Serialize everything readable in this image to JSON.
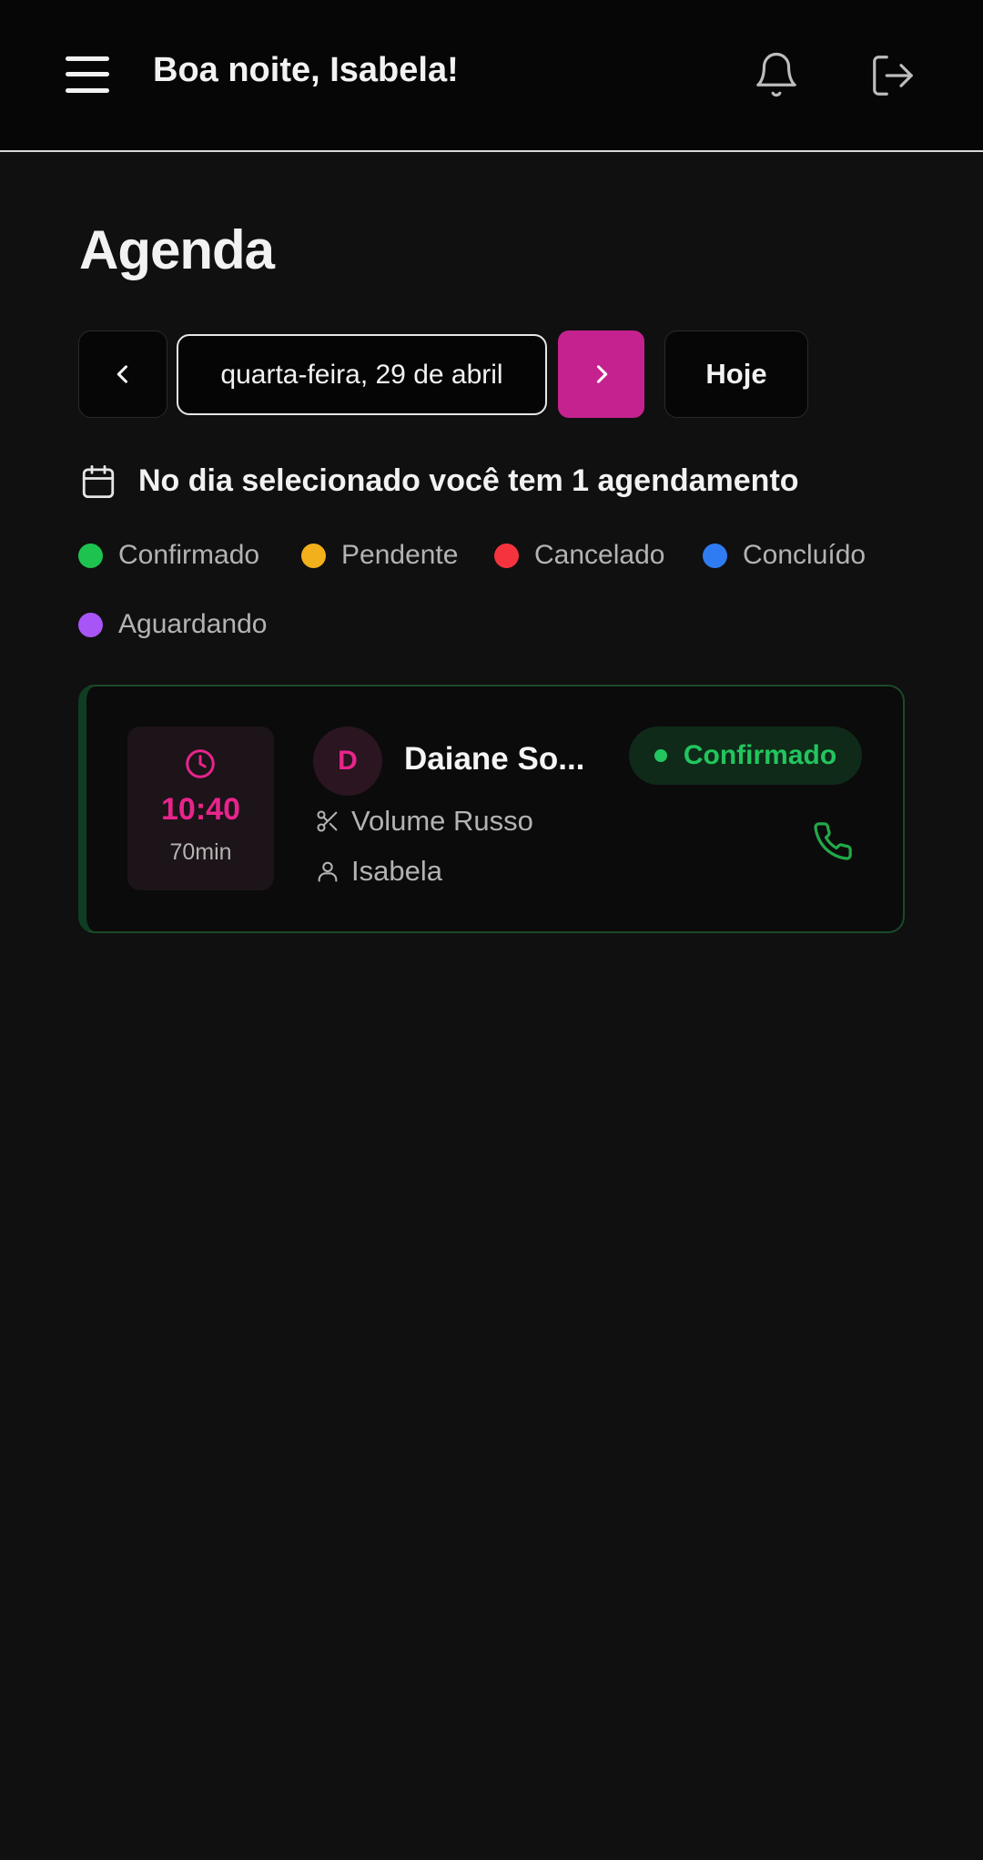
{
  "header": {
    "greeting": "Boa noite,  Isabela!",
    "menu_icon": "hamburger-menu-icon",
    "notifications_icon": "bell-icon",
    "logout_icon": "logout-icon"
  },
  "page": {
    "title": "Agenda"
  },
  "date_nav": {
    "selected_date": "quarta-feira, 29 de abril",
    "today_label": "Hoje",
    "accent_color": "#c5228f"
  },
  "summary": {
    "text": "No dia selecionado você tem 1 agendamento"
  },
  "legend": {
    "items": [
      {
        "label": "Confirmado",
        "color": "#1ec34f"
      },
      {
        "label": "Pendente",
        "color": "#f2b01c"
      },
      {
        "label": "Cancelado",
        "color": "#f5333f"
      },
      {
        "label": "Concluído",
        "color": "#2f7cf2"
      },
      {
        "label": "Aguardando",
        "color": "#a855f7"
      }
    ]
  },
  "appointments": [
    {
      "time": "10:40",
      "duration": "70min",
      "avatar_letter": "D",
      "client_name": "Daiane So...",
      "service": "Volume Russo",
      "professional": "Isabela",
      "status": "Confirmado",
      "status_color": "#22c55e",
      "time_color": "#e8248c"
    }
  ]
}
